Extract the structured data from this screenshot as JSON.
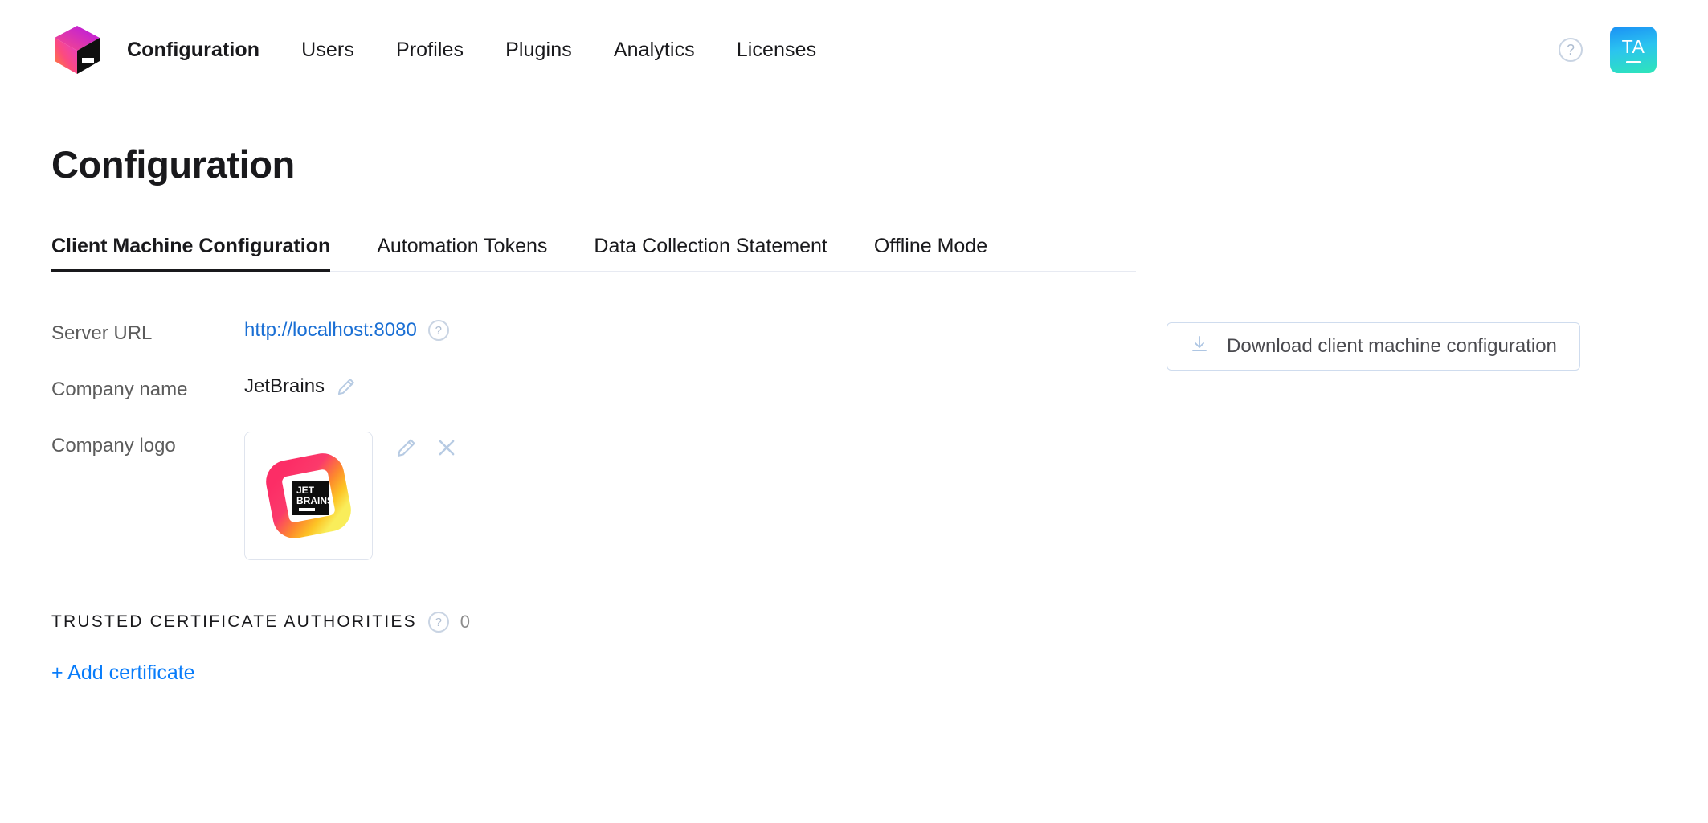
{
  "header": {
    "logo_icon": "ide-services-cube-logo",
    "nav": [
      {
        "label": "Configuration",
        "active": true
      },
      {
        "label": "Users",
        "active": false
      },
      {
        "label": "Profiles",
        "active": false
      },
      {
        "label": "Plugins",
        "active": false
      },
      {
        "label": "Analytics",
        "active": false
      },
      {
        "label": "Licenses",
        "active": false
      }
    ],
    "help_icon": "help-circle-icon",
    "help_glyph": "?",
    "avatar": {
      "initials": "TA",
      "gradient_from": "#1a90f5",
      "gradient_to": "#2ee6b8"
    }
  },
  "page": {
    "title": "Configuration"
  },
  "tabs": [
    {
      "label": "Client Machine Configuration",
      "active": true
    },
    {
      "label": "Automation Tokens",
      "active": false
    },
    {
      "label": "Data Collection Statement",
      "active": false
    },
    {
      "label": "Offline Mode",
      "active": false
    }
  ],
  "form": {
    "server_url": {
      "label": "Server URL",
      "value": "http://localhost:8080",
      "help_glyph": "?",
      "link_color": "#1a6fd4"
    },
    "company_name": {
      "label": "Company name",
      "value": "JetBrains",
      "edit_icon": "pencil-icon"
    },
    "company_logo": {
      "label": "Company logo",
      "logo_alt": "jetbrains-logo",
      "logo_text_line1": "JET",
      "logo_text_line2": "BRAINS",
      "edit_icon": "pencil-icon",
      "remove_icon": "close-icon"
    }
  },
  "certificates": {
    "section_title": "Trusted Certificate Authorities",
    "help_glyph": "?",
    "count": "0",
    "add_label": "+ Add certificate",
    "add_color": "#087cfa"
  },
  "actions": {
    "download_label": "Download client machine configuration",
    "download_icon": "download-icon"
  }
}
